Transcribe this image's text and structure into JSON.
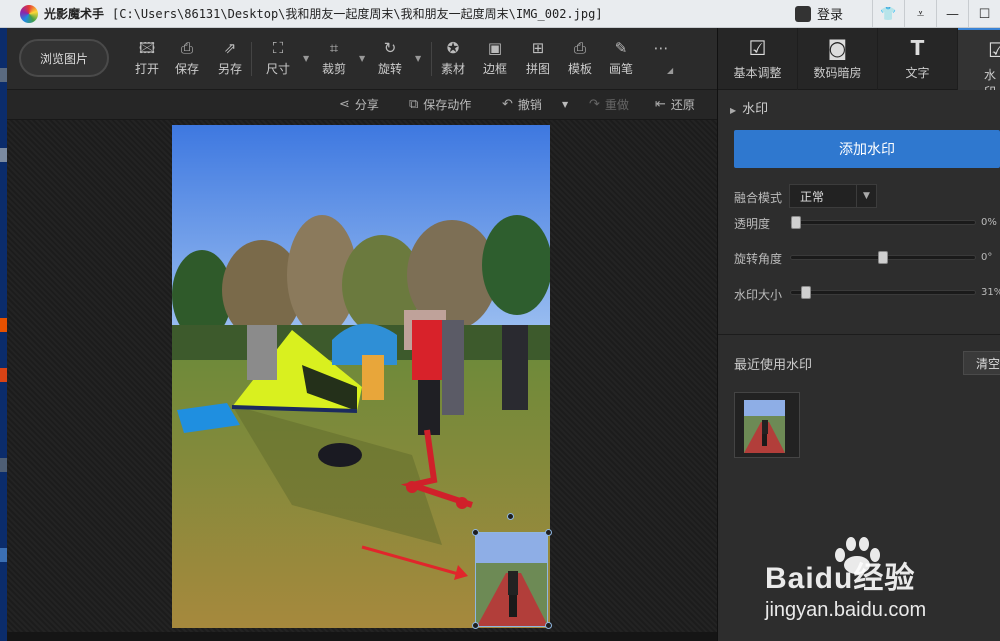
{
  "titlebar": {
    "app_name": "光影魔术手",
    "path": "[C:\\Users\\86131\\Desktop\\我和朋友一起度周末\\我和朋友一起度周末\\IMG_002.jpg]",
    "login": "登录",
    "buttons": [
      "shirt-icon",
      "dropdown-icon",
      "minimize-icon",
      "maximize-icon"
    ]
  },
  "toolbar": {
    "browse": "浏览图片",
    "tools": [
      {
        "label": "打开",
        "icon": "open-icon"
      },
      {
        "label": "保存",
        "icon": "save-icon"
      },
      {
        "label": "另存",
        "icon": "save-as-icon"
      },
      {
        "label": "尺寸",
        "icon": "resize-icon"
      },
      {
        "label": "裁剪",
        "icon": "crop-icon"
      },
      {
        "label": "旋转",
        "icon": "rotate-icon"
      },
      {
        "label": "素材",
        "icon": "material-icon"
      },
      {
        "label": "边框",
        "icon": "border-icon"
      },
      {
        "label": "拼图",
        "icon": "collage-icon"
      },
      {
        "label": "模板",
        "icon": "template-icon"
      },
      {
        "label": "画笔",
        "icon": "brush-icon"
      }
    ]
  },
  "subbar": {
    "share": "分享",
    "save_action": "保存动作",
    "undo": "撤销",
    "redo": "重做",
    "restore": "还原"
  },
  "right_panel": {
    "tabs": [
      {
        "label": "基本调整",
        "icon": "adjust-icon"
      },
      {
        "label": "数码暗房",
        "icon": "camera-icon"
      },
      {
        "label": "文字",
        "icon": "text-icon"
      },
      {
        "label": "水印",
        "icon": "watermark-icon"
      }
    ],
    "section_title": "水印",
    "add_watermark": "添加水印",
    "blend_mode_label": "融合模式",
    "blend_mode_value": "正常",
    "opacity_label": "透明度",
    "opacity_value": "0%",
    "opacity_level": 0,
    "rotation_label": "旋转角度",
    "rotation_value": "0°",
    "rotation_level": 0.5,
    "size_label": "水印大小",
    "size_value": "31%",
    "size_level": 0.06,
    "recent_title": "最近使用水印",
    "clear": "清空"
  },
  "footer_brand": {
    "logo": "Baidu经验",
    "url": "jingyan.baidu.com"
  },
  "colors": {
    "accent": "#2f78cf",
    "panel_bg": "#2d2d2d",
    "toolbar_bg": "#2b2b2b"
  }
}
